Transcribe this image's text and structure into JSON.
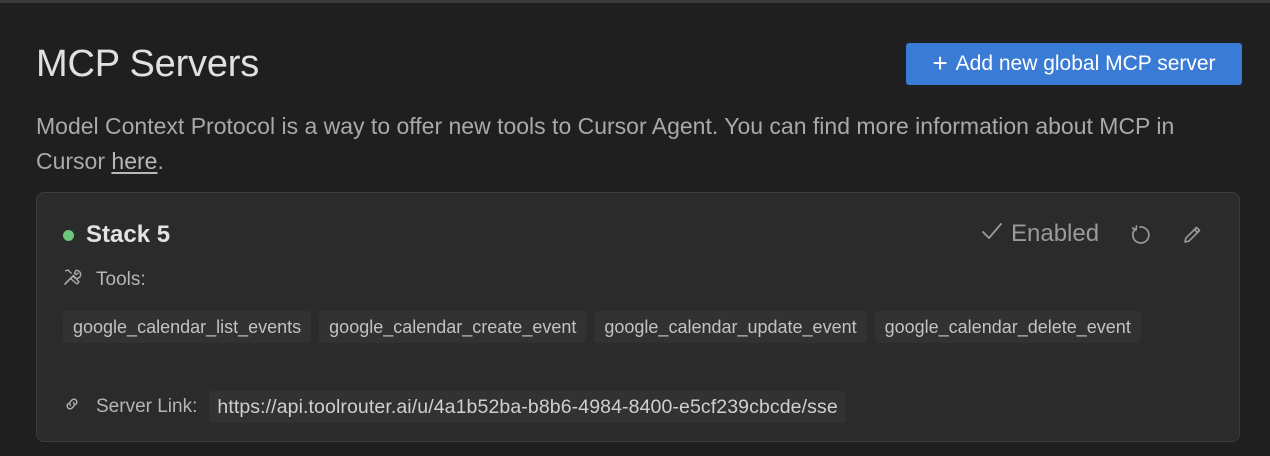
{
  "header": {
    "title": "MCP Servers",
    "add_button_label": "Add new global MCP server"
  },
  "description": {
    "text": "Model Context Protocol is a way to offer new tools to Cursor Agent. You can find more information about MCP in Cursor ",
    "link_text": "here",
    "suffix": "."
  },
  "server": {
    "name": "Stack 5",
    "status_color": "#6cc77a",
    "enabled_label": "Enabled",
    "tools_label": "Tools:",
    "tools": [
      "google_calendar_list_events",
      "google_calendar_create_event",
      "google_calendar_update_event",
      "google_calendar_delete_event"
    ],
    "server_link_label": "Server Link:",
    "server_link": "https://api.toolrouter.ai/u/4a1b52ba-b8b6-4984-8400-e5cf239cbcde/sse"
  },
  "colors": {
    "accent": "#3a7bd5",
    "background": "#1f1f1f",
    "card": "#2b2b2b"
  }
}
